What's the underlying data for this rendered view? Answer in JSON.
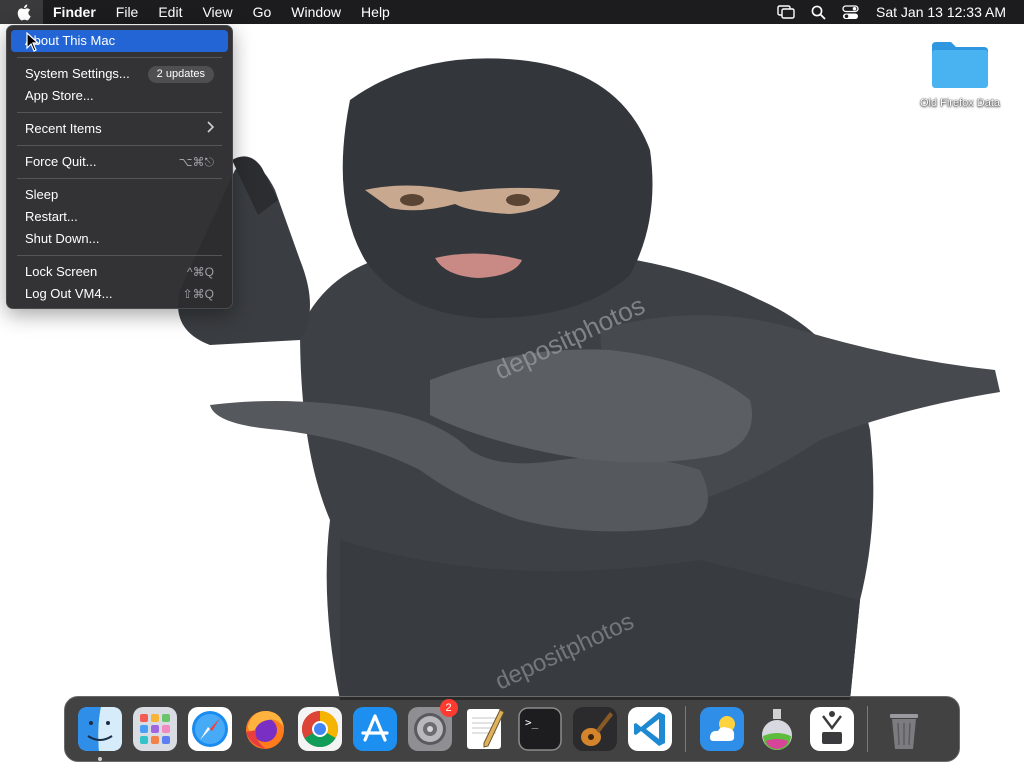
{
  "menubar": {
    "app_name": "Finder",
    "menus": [
      "File",
      "Edit",
      "View",
      "Go",
      "Window",
      "Help"
    ],
    "clock": "Sat Jan 13  12:33 AM"
  },
  "apple_menu": {
    "about": "About This Mac",
    "system_settings": "System Settings...",
    "updates_badge": "2 updates",
    "app_store": "App Store...",
    "recent_items": "Recent Items",
    "force_quit": "Force Quit...",
    "force_quit_shortcut": "⌥⌘⎋",
    "sleep": "Sleep",
    "restart": "Restart...",
    "shut_down": "Shut Down...",
    "lock_screen": "Lock Screen",
    "lock_screen_shortcut": "^⌘Q",
    "log_out": "Log Out VM4...",
    "log_out_shortcut": "⇧⌘Q"
  },
  "desktop": {
    "folder_label": "Old Firefox Data",
    "watermark": "depositphotos"
  },
  "dock": {
    "apps": [
      {
        "name": "Finder",
        "icon": "finder-icon",
        "running": true
      },
      {
        "name": "Launchpad",
        "icon": "launchpad-icon"
      },
      {
        "name": "Safari",
        "icon": "safari-icon"
      },
      {
        "name": "Firefox",
        "icon": "firefox-icon"
      },
      {
        "name": "Google Chrome",
        "icon": "chrome-icon"
      },
      {
        "name": "App Store",
        "icon": "app-store-icon"
      },
      {
        "name": "System Settings",
        "icon": "system-settings-icon",
        "badge": "2"
      },
      {
        "name": "TextEdit",
        "icon": "textedit-icon"
      },
      {
        "name": "Terminal",
        "icon": "terminal-icon"
      },
      {
        "name": "GarageBand",
        "icon": "garageband-icon"
      },
      {
        "name": "Visual Studio Code",
        "icon": "vscode-icon"
      },
      {
        "name": "Weather",
        "icon": "weather-icon"
      },
      {
        "name": "Automator",
        "icon": "potion-icon"
      },
      {
        "name": "System Information",
        "icon": "system-info-icon"
      },
      {
        "name": "Trash",
        "icon": "trash-icon"
      }
    ],
    "terminal_prompt": ">_"
  },
  "colors": {
    "menubar_bg": "#1c1c1e",
    "menu_highlight": "#2465d6",
    "folder_blue": "#3aa6ee",
    "badge_red": "#ff3b30"
  }
}
